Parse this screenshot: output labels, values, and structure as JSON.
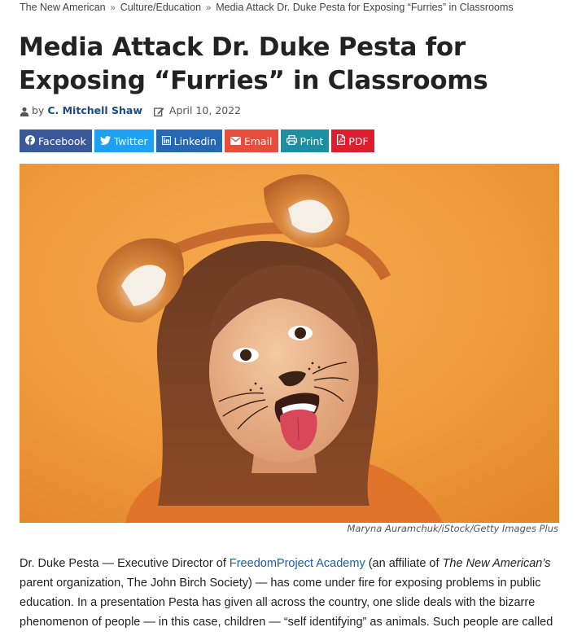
{
  "breadcrumb": {
    "items": [
      "The New American",
      "Culture/Education",
      "Media Attack Dr. Duke Pesta for Exposing “Furries” in Classrooms"
    ],
    "separator": "»"
  },
  "article": {
    "title": "Media Attack Dr. Duke Pesta for Exposing “Furries” in Classrooms",
    "by_label": "by",
    "author": "C. Mitchell Shaw",
    "date": "April 10, 2022"
  },
  "share": {
    "facebook": {
      "label": "Facebook",
      "color": "#3b5998",
      "icon": "facebook-icon"
    },
    "twitter": {
      "label": "Twitter",
      "color": "#1da1f2",
      "icon": "twitter-icon"
    },
    "linkedin": {
      "label": "Linkedin",
      "color": "#2867b2",
      "icon": "linkedin-icon"
    },
    "email": {
      "label": "Email",
      "color": "#e74c3c",
      "icon": "envelope-icon"
    },
    "print": {
      "label": "Print",
      "color": "#1e8fa3",
      "icon": "printer-icon"
    },
    "pdf": {
      "label": "PDF",
      "color": "#dc1f2e",
      "icon": "pdf-icon"
    }
  },
  "image": {
    "caption": "Maryna Auramchuk/iStock/Getty Images Plus"
  },
  "body": {
    "p1_part1": "Dr. Duke Pesta — Executive Director of ",
    "p1_link": "FreedomProject Academy",
    "p1_part2": " (an affiliate of ",
    "p1_italic": "The New American’s",
    "p1_part3": " parent organization, The John Birch Society) — has come under fire for exposing problems in public education. In a presentation Pesta has given all across the country, one slide deals with the bizarre phenomenon of people — in this case, children — “self identifying” as animals. Such people are called"
  }
}
